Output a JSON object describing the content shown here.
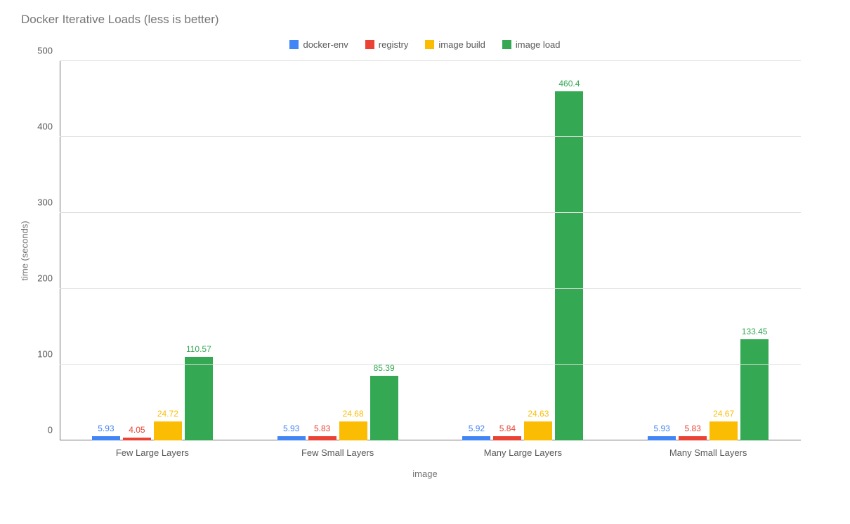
{
  "chart_data": {
    "type": "bar",
    "title": "Docker Iterative Loads (less is better)",
    "xlabel": "image",
    "ylabel": "time (seconds)",
    "ylim": [
      0,
      500
    ],
    "yticks": [
      0,
      100,
      200,
      300,
      400,
      500
    ],
    "categories": [
      "Few Large Layers",
      "Few Small Layers",
      "Many Large Layers",
      "Many Small Layers"
    ],
    "series": [
      {
        "name": "docker-env",
        "color": "#4285f4",
        "values": [
          5.93,
          5.93,
          5.92,
          5.93
        ]
      },
      {
        "name": "registry",
        "color": "#ea4335",
        "values": [
          4.05,
          5.83,
          5.84,
          5.83
        ]
      },
      {
        "name": "image build",
        "color": "#fbbc04",
        "values": [
          24.72,
          24.68,
          24.63,
          24.67
        ]
      },
      {
        "name": "image load",
        "color": "#34a853",
        "values": [
          110.57,
          85.39,
          460.4,
          133.45
        ]
      }
    ]
  }
}
